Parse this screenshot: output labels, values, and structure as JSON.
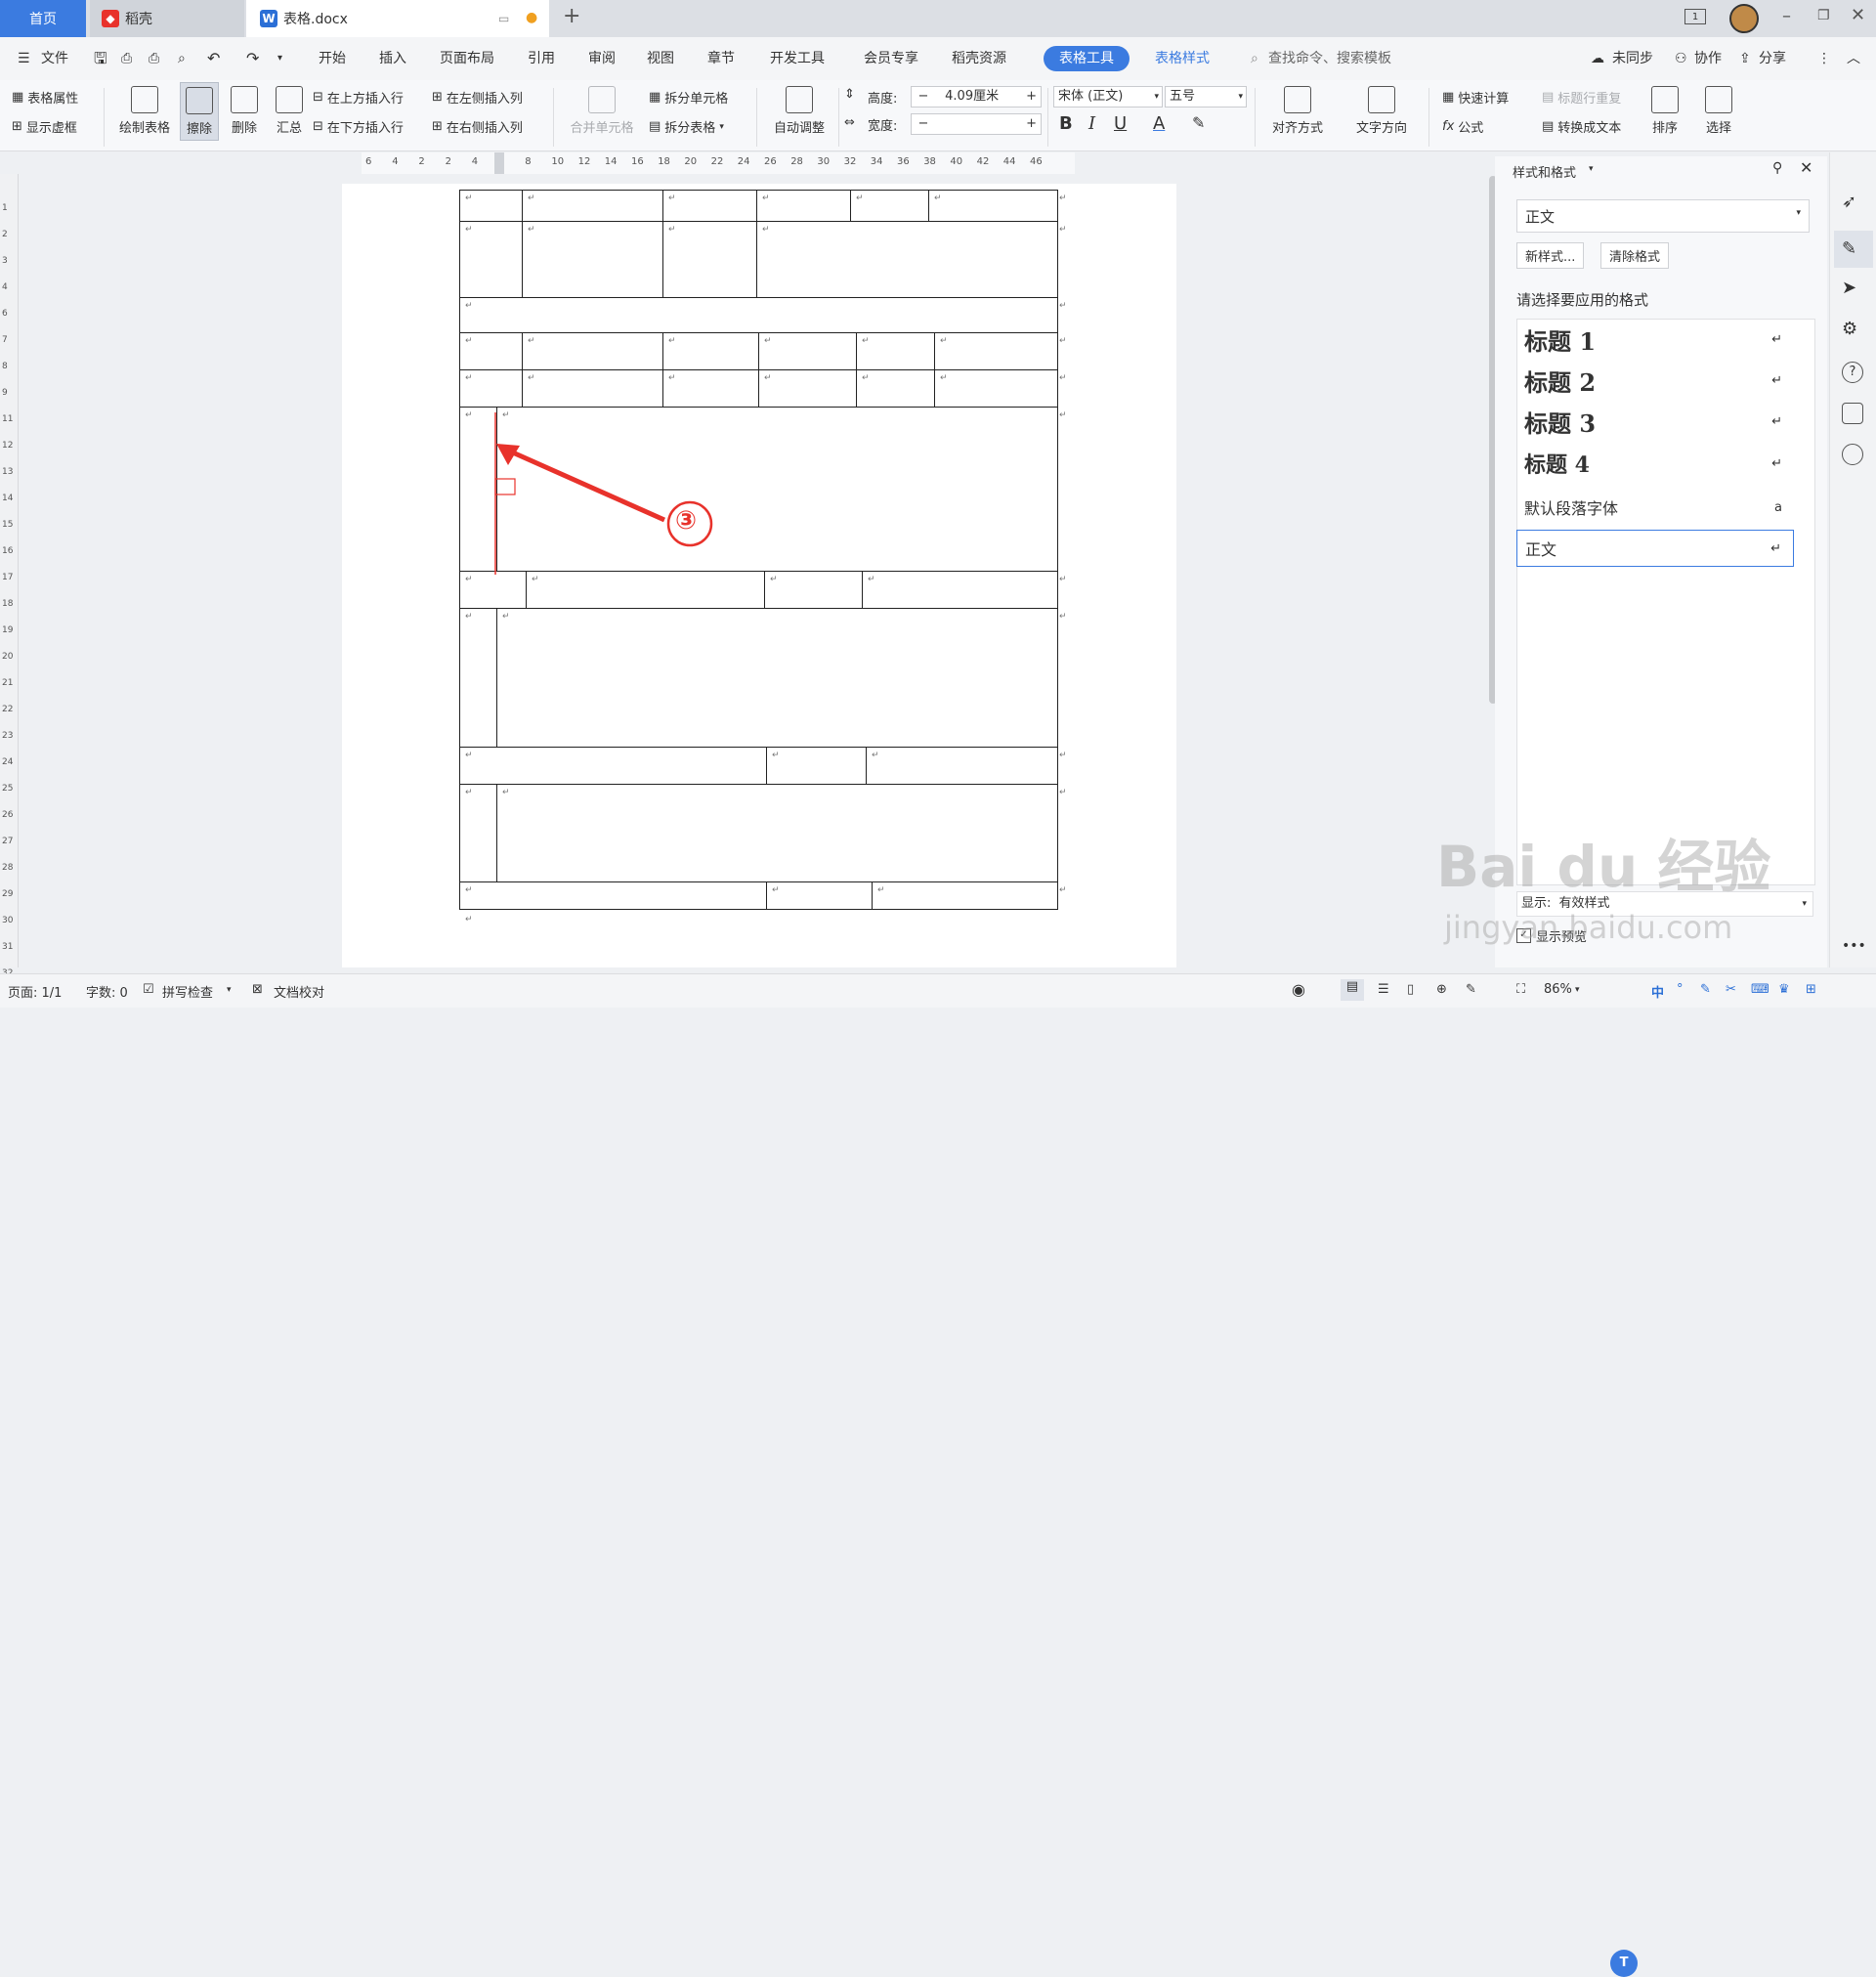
{
  "titlebar": {
    "tab_home": "首页",
    "tab_docer": "稻壳",
    "tab_doc": "表格.docx",
    "new_tab": "+",
    "window_badge": "1"
  },
  "menubar": {
    "file": "文件",
    "items": [
      "开始",
      "插入",
      "页面布局",
      "引用",
      "审阅",
      "视图",
      "章节",
      "开发工具",
      "会员专享",
      "稻壳资源"
    ],
    "active_tab": "表格工具",
    "table_style_tab": "表格样式",
    "search": "查找命令、搜索模板",
    "sync": "未同步",
    "collab": "协作",
    "share": "分享"
  },
  "ribbon": {
    "table_props": "表格属性",
    "show_grid": "显示虚框",
    "draw_table": "绘制表格",
    "erase": "擦除",
    "delete": "删除",
    "summary": "汇总",
    "insert_above": "在上方插入行",
    "insert_below": "在下方插入行",
    "insert_left": "在左侧插入列",
    "insert_right": "在右侧插入列",
    "merge_cells": "合并单元格",
    "split_cells": "拆分单元格",
    "split_table": "拆分表格",
    "auto_fit": "自动调整",
    "height_label": "高度:",
    "height_value": "4.09厘米",
    "width_label": "宽度:",
    "width_value": "",
    "minus": "−",
    "plus": "+",
    "font_name": "宋体 (正文)",
    "font_size": "五号",
    "bold": "B",
    "italic": "I",
    "underline": "U",
    "font_color": "A",
    "align": "对齐方式",
    "text_dir": "文字方向",
    "quick_calc": "快速计算",
    "repeat_header": "标题行重复",
    "formula": "公式",
    "to_text": "转换成文本",
    "sort": "排序",
    "select": "选择"
  },
  "ruler_ticks": [
    "6",
    "4",
    "2",
    "2",
    "4",
    "6",
    "8",
    "10",
    "12",
    "14",
    "16",
    "18",
    "20",
    "22",
    "24",
    "26",
    "28",
    "30",
    "32",
    "34",
    "36",
    "38",
    "40",
    "42",
    "44",
    "46"
  ],
  "vruler_ticks": [
    "1",
    "2",
    "3",
    "4",
    "6",
    "7",
    "8",
    "9",
    "11",
    "12",
    "13",
    "14",
    "15",
    "16",
    "17",
    "18",
    "19",
    "20",
    "21",
    "22",
    "23",
    "24",
    "25",
    "26",
    "27",
    "28",
    "29",
    "30",
    "31",
    "32"
  ],
  "paragraph_mark": "↵",
  "annotation": "③",
  "panel": {
    "title": "样式和格式",
    "current_style": "正文",
    "new_style": "新样式...",
    "clear_format": "清除格式",
    "prompt": "请选择要应用的格式",
    "styles": [
      {
        "label": "标题  1",
        "mark": "↵"
      },
      {
        "label": "标题  2",
        "mark": "↵"
      },
      {
        "label": "标题  3",
        "mark": "↵"
      },
      {
        "label": "标题  4",
        "mark": "↵"
      },
      {
        "label": "默认段落字体",
        "mark": "a"
      },
      {
        "label": "正文",
        "mark": "↵"
      }
    ],
    "show_label": "显示:",
    "show_value": "有效样式",
    "preview": "显示预览"
  },
  "statusbar": {
    "page": "页面: 1/1",
    "words": "字数: 0",
    "spell": "拼写检查",
    "proof": "文档校对",
    "zoom": "86%",
    "ime": "中"
  },
  "watermark": {
    "main": "Bai du 经验",
    "sub": "jingyan.baidu.com"
  },
  "colors": {
    "accent": "#3b7be0",
    "annotation": "#e8322b"
  }
}
